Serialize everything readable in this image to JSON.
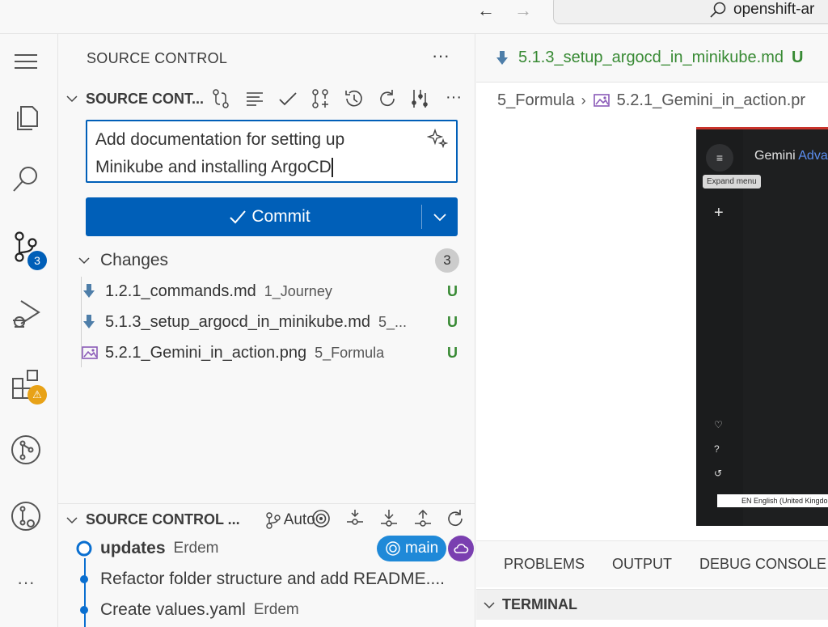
{
  "titlebar": {
    "search_text": "openshift-ar"
  },
  "activity_bar": {
    "scm_badge": "3",
    "extensions_badge": "⚠"
  },
  "sidebar": {
    "title": "SOURCE CONTROL",
    "more": "···",
    "repo_section": {
      "title": "SOURCE CONT...",
      "commit_message_line1": "Add documentation for setting up",
      "commit_message_line2": "Minikube and installing ArgoCD",
      "commit_label": "Commit",
      "changes_label": "Changes",
      "changes_count": "3",
      "files": [
        {
          "name": "1.2.1_commands.md",
          "dir": "1_Journey",
          "status": "U",
          "icon": "markdown-down-arrow-icon"
        },
        {
          "name": "5.1.3_setup_argocd_in_minikube.md",
          "dir": "5_...",
          "status": "U",
          "icon": "markdown-down-arrow-icon"
        },
        {
          "name": "5.2.1_Gemini_in_action.png",
          "dir": "5_Formula",
          "status": "U",
          "icon": "image-icon"
        }
      ]
    },
    "graph_section": {
      "title": "SOURCE CONTROL ...",
      "auto_label": "Auto",
      "commits": [
        {
          "message": "updates",
          "author": "Erdem",
          "bold": true
        },
        {
          "message": "Refactor folder structure and add README....",
          "author": ""
        },
        {
          "message": "Create values.yaml",
          "author": "Erdem"
        }
      ],
      "branch_label": "main"
    }
  },
  "editor": {
    "tab_title": "5.1.3_setup_argocd_in_minikube.md",
    "tab_status": "U",
    "breadcrumb": [
      "5_Formula",
      "5.2.1_Gemini_in_action.pr"
    ],
    "preview": {
      "title_main": "Gemini",
      "title_accent": "Adva",
      "tooltip": "Expand menu",
      "footer": "EN English (United Kingdom"
    }
  },
  "panel": {
    "tabs": [
      "PROBLEMS",
      "OUTPUT",
      "DEBUG CONSOLE"
    ],
    "terminal_label": "TERMINAL"
  },
  "colors": {
    "accent": "#005fb8",
    "untracked": "#388a34",
    "branch_pill": "#1f89d8",
    "cloud_pill": "#7a3fb0",
    "warning": "#e8a217"
  }
}
